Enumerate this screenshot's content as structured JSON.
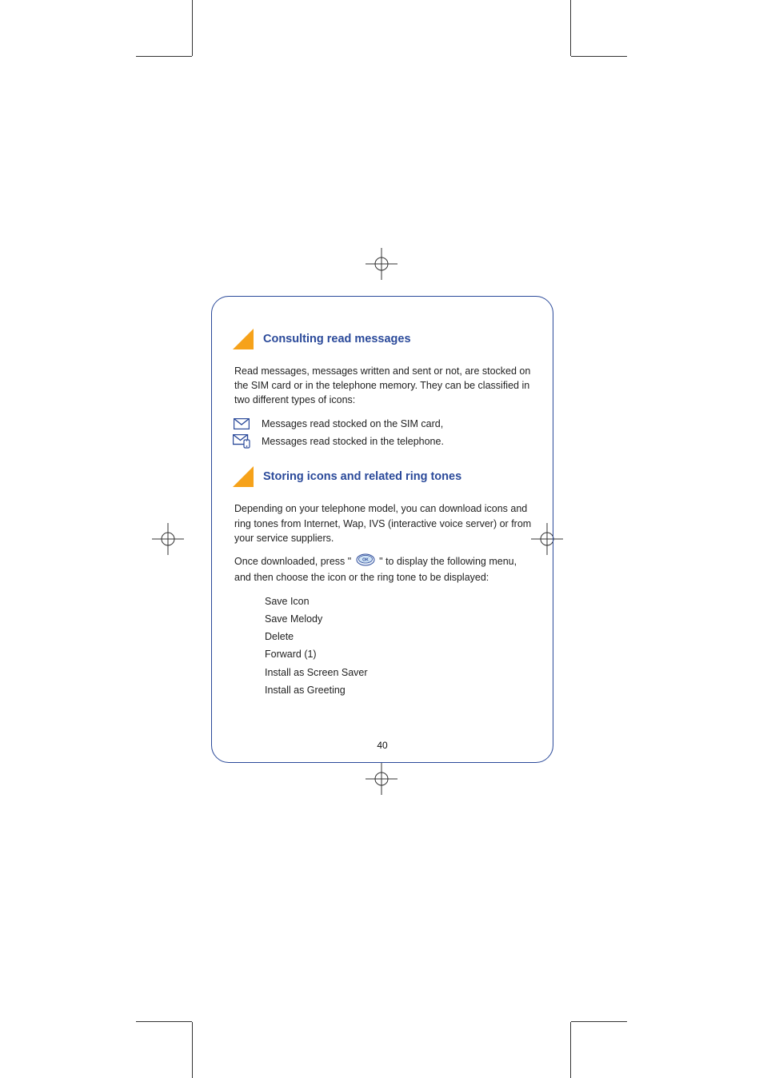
{
  "section1": {
    "title": "Consulting read messages",
    "paragraph": "Read messages, messages written and sent or not, are stocked on the SIM card or in the telephone memory. They can be classified in two different types of icons:",
    "iconRows": [
      {
        "label": "Messages read stocked on the SIM card,"
      },
      {
        "label": "Messages read stocked in the telephone."
      }
    ]
  },
  "section2": {
    "title": "Storing icons and related ring tones",
    "paragraphs": [
      "Depending on your telephone model, you can download icons and ring tones from Internet, Wap, IVS (interactive voice server) or from your service suppliers.",
      "Once downloaded, press \"",
      "\" to display the following menu, and then choose the icon or the ring tone to be displayed:"
    ],
    "menu": [
      "Save Icon",
      "Save Melody",
      "Delete",
      "Forward (1)",
      "Install as Screen Saver",
      "Install as Greeting"
    ]
  },
  "pageNumber": "40"
}
